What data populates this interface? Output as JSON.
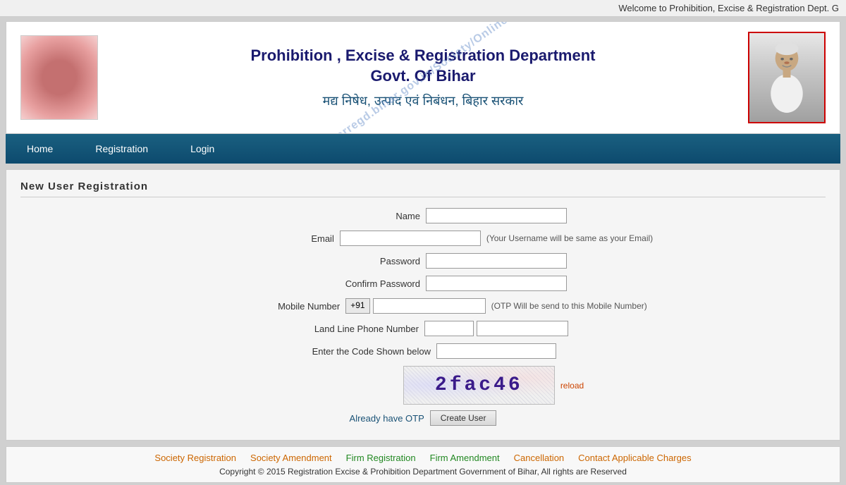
{
  "topbar": {
    "text": "Welcome to Prohibition, Excise & Registration Dept. G"
  },
  "header": {
    "title_line1": "Prohibition , Excise & Registration Department",
    "title_line2": "Govt. Of Bihar",
    "title_hindi": "मद्य निषेध, उत्पाद एवं निबंधन, बिहार सरकार",
    "watermark": "Source/From: https://biharregd.bihar.gov.in/Society/Online/OnlineRegistration.aspx"
  },
  "navbar": {
    "items": [
      {
        "label": "Home",
        "id": "home"
      },
      {
        "label": "Registration",
        "id": "registration"
      },
      {
        "label": "Login",
        "id": "login"
      }
    ]
  },
  "main": {
    "section_title": "New User Registration",
    "form": {
      "name_label": "Name",
      "email_label": "Email",
      "email_hint": "(Your Username will be same as your Email)",
      "password_label": "Password",
      "confirm_password_label": "Confirm Password",
      "mobile_label": "Mobile Number",
      "mobile_prefix": "+91",
      "mobile_hint": "(OTP Will be send to this Mobile Number)",
      "landline_label": "Land Line Phone Number",
      "captcha_label": "Enter the Code Shown below",
      "captcha_text": "2fac46",
      "reload_label": "reload",
      "otp_label": "Already have OTP",
      "create_user_label": "Create User"
    }
  },
  "footer": {
    "links": [
      {
        "label": "Society Registration",
        "color": "orange"
      },
      {
        "label": "Society Amendment",
        "color": "orange"
      },
      {
        "label": "Firm Registration",
        "color": "green"
      },
      {
        "label": "Firm Amendment",
        "color": "green"
      },
      {
        "label": "Cancellation",
        "color": "orange"
      },
      {
        "label": "Contact Applicable Charges",
        "color": "orange"
      }
    ],
    "copyright": "Copyright © 2015 Registration Excise & Prohibition Department Government of Bihar, All rights are Reserved"
  }
}
